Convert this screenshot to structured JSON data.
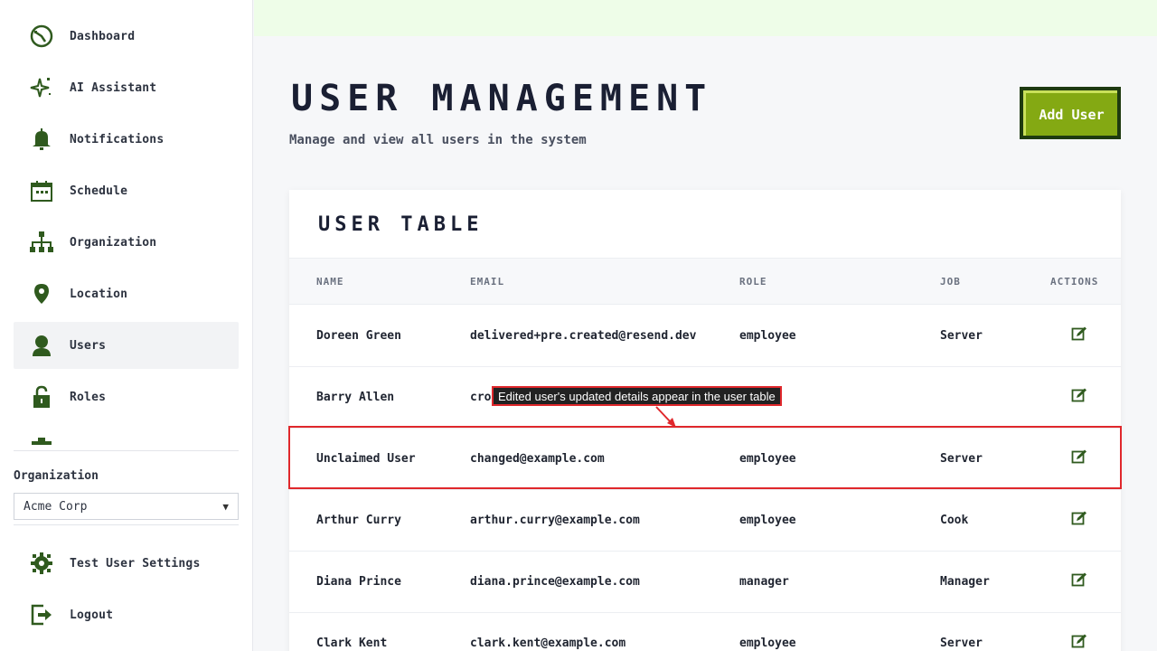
{
  "sidebar": {
    "items": [
      {
        "label": "Dashboard",
        "icon": "dashboard-icon"
      },
      {
        "label": "AI Assistant",
        "icon": "sparkle-icon"
      },
      {
        "label": "Notifications",
        "icon": "bell-icon"
      },
      {
        "label": "Schedule",
        "icon": "calendar-icon"
      },
      {
        "label": "Organization",
        "icon": "org-chart-icon"
      },
      {
        "label": "Location",
        "icon": "map-pin-icon"
      },
      {
        "label": "Users",
        "icon": "user-icon",
        "active": true
      },
      {
        "label": "Roles",
        "icon": "lock-icon"
      }
    ],
    "org_label": "Organization",
    "org_selected": "Acme Corp",
    "settings_label": "Test User Settings",
    "logout_label": "Logout"
  },
  "header": {
    "title": "User Management",
    "subtitle": "Manage and view all users in the system",
    "add_button": "Add User"
  },
  "table": {
    "title": "User Table",
    "columns": [
      "NAME",
      "EMAIL",
      "ROLE",
      "JOB",
      "ACTIONS"
    ],
    "rows": [
      {
        "name": "Doreen Green",
        "email": "delivered+pre.created@resend.dev",
        "role": "employee",
        "job": "Server"
      },
      {
        "name": "Barry Allen",
        "email": "cros",
        "role": "",
        "job": ""
      },
      {
        "name": "Unclaimed User",
        "email": "changed@example.com",
        "role": "employee",
        "job": "Server"
      },
      {
        "name": "Arthur Curry",
        "email": "arthur.curry@example.com",
        "role": "employee",
        "job": "Cook"
      },
      {
        "name": "Diana Prince",
        "email": "diana.prince@example.com",
        "role": "manager",
        "job": "Manager"
      },
      {
        "name": "Clark Kent",
        "email": "clark.kent@example.com",
        "role": "employee",
        "job": "Server"
      }
    ]
  },
  "annotation": {
    "text": "Edited user's updated details appear in the user table"
  },
  "colors": {
    "accent_green": "#2f5a1e",
    "button_fill": "#84a913",
    "highlight": "#e0282c"
  }
}
